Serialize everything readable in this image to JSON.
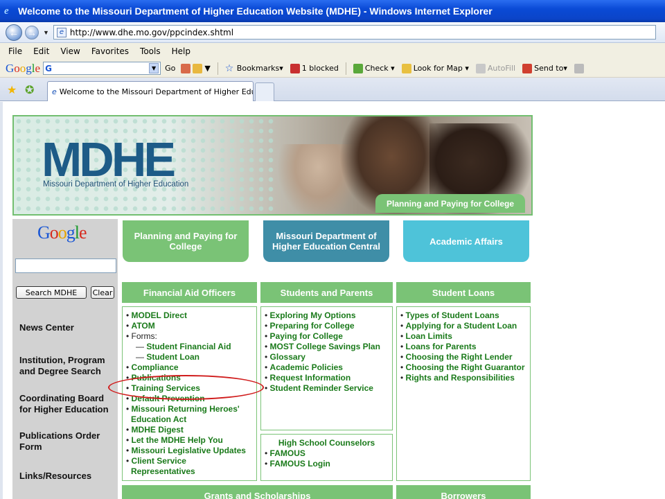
{
  "browser": {
    "title": "Welcome to the Missouri Department of Higher Education Website (MDHE) - Windows Internet Explorer",
    "address": "http://www.dhe.mo.gov/ppcindex.shtml",
    "menu": [
      "File",
      "Edit",
      "View",
      "Favorites",
      "Tools",
      "Help"
    ],
    "google_toolbar": {
      "go": "Go",
      "bookmarks": "Bookmarks",
      "blocked": "1 blocked",
      "check": "Check",
      "look_for_map": "Look for Map",
      "autofill": "AutoFill",
      "send_to": "Send to"
    },
    "tab_title": "Welcome to the Missouri Department of Higher Educat..."
  },
  "banner": {
    "logo": "MDHE",
    "subtitle": "Missouri Department of Higher Education",
    "tag": "Planning and Paying for College"
  },
  "sidebar": {
    "search_button": "Search MDHE",
    "clear_button": "Clear",
    "items": [
      {
        "label": "News Center"
      },
      {
        "label": "Institution, Program and Degree Search"
      },
      {
        "label": "Coordinating Board for Higher Education"
      },
      {
        "label": "Publications Order Form"
      },
      {
        "label": "Links/Resources"
      }
    ]
  },
  "top_buttons": [
    {
      "label": "Planning and Paying for College",
      "color": "#7ac376"
    },
    {
      "label": "Missouri Department of Higher Education Central",
      "color": "#3f8ea7"
    },
    {
      "label": "Academic Affairs",
      "color": "#4ec3d9"
    }
  ],
  "sections": {
    "financial_aid_officers": {
      "header": "Financial Aid Officers",
      "links": [
        "MODEL Direct",
        "ATOM",
        "Forms:",
        "Student Financial Aid",
        "Student Loan",
        "Compliance",
        "Publications",
        "Training Services",
        "Default Prevention",
        "Missouri Returning Heroes' Education Act",
        "MDHE Digest",
        "Let the MDHE Help You",
        "Missouri Legislative Updates",
        "Client Service Representatives"
      ]
    },
    "students_and_parents": {
      "header": "Students and Parents",
      "links": [
        "Exploring My Options",
        "Preparing for College",
        "Paying for College",
        "MOST College Savings Plan",
        "Glossary",
        "Academic Policies",
        "Request Information",
        "Student Reminder Service"
      ]
    },
    "high_school_counselors": {
      "header": "High School Counselors",
      "links": [
        "FAMOUS",
        "FAMOUS Login"
      ]
    },
    "student_loans": {
      "header": "Student Loans",
      "links": [
        "Types of Student Loans",
        "Applying for a Student Loan",
        "Loan Limits",
        "Loans for Parents",
        "Choosing the Right Lender",
        "Choosing the Right Guarantor",
        "Rights and Responsibilities"
      ]
    },
    "grants_and_scholarships": {
      "header": "Grants and Scholarships"
    },
    "borrowers": {
      "header": "Borrowers"
    }
  }
}
